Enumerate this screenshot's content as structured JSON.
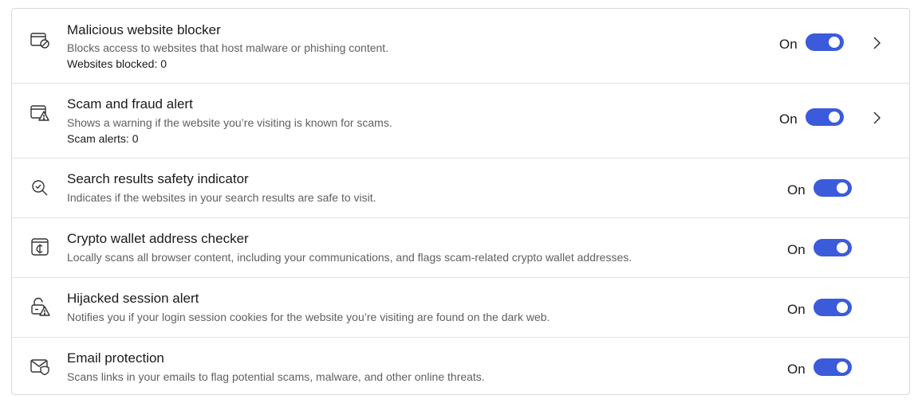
{
  "colors": {
    "accent": "#3b5bdb",
    "text": "#1a1a1a",
    "muted": "#5f5f5f",
    "border": "#d9d9d9"
  },
  "features": [
    {
      "icon": "browser-block-icon",
      "title": "Malicious website blocker",
      "description": "Blocks access to websites that host malware or phishing content.",
      "stat": "Websites blocked: 0",
      "state": "On",
      "enabled": true,
      "has_details": true
    },
    {
      "icon": "browser-warning-icon",
      "title": "Scam and fraud alert",
      "description": "Shows a warning if the website you’re visiting is known for scams.",
      "stat": "Scam alerts: 0",
      "state": "On",
      "enabled": true,
      "has_details": true
    },
    {
      "icon": "search-check-icon",
      "title": "Search results safety indicator",
      "description": "Indicates if the websites in your search results are safe to visit.",
      "state": "On",
      "enabled": true,
      "has_details": false
    },
    {
      "icon": "crypto-wallet-icon",
      "title": "Crypto wallet address checker",
      "description": "Locally scans all browser content, including your communications, and flags scam-related crypto wallet addresses.",
      "state": "On",
      "enabled": true,
      "has_details": false
    },
    {
      "icon": "lock-warning-icon",
      "title": "Hijacked session alert",
      "description": "Notifies you if your login session cookies for the website you’re visiting are found on the dark web.",
      "state": "On",
      "enabled": true,
      "has_details": false
    },
    {
      "icon": "email-shield-icon",
      "title": "Email protection",
      "description": "Scans links in your emails to flag potential scams, malware, and other online threats.",
      "state": "On",
      "enabled": true,
      "has_details": false
    }
  ]
}
